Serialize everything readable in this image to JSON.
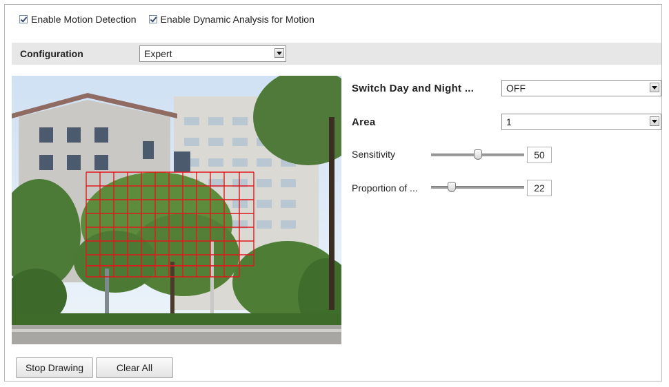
{
  "options": {
    "motion_detection": {
      "label": "Enable Motion Detection",
      "checked": true
    },
    "dynamic_analysis": {
      "label": "Enable Dynamic Analysis for Motion",
      "checked": true
    }
  },
  "configuration": {
    "label": "Configuration",
    "value": "Expert"
  },
  "settings": {
    "switch_day_night": {
      "label": "Switch Day and Night ...",
      "value": "OFF"
    },
    "area": {
      "label": "Area",
      "value": "1"
    },
    "sensitivity": {
      "label": "Sensitivity",
      "value": "50"
    },
    "proportion": {
      "label": "Proportion of ...",
      "value": "22"
    }
  },
  "actions": {
    "stop_drawing": "Stop Drawing",
    "clear_all": "Clear All"
  },
  "colors": {
    "grid": "#e0191b",
    "panel_bg": "#e7e7e7"
  }
}
